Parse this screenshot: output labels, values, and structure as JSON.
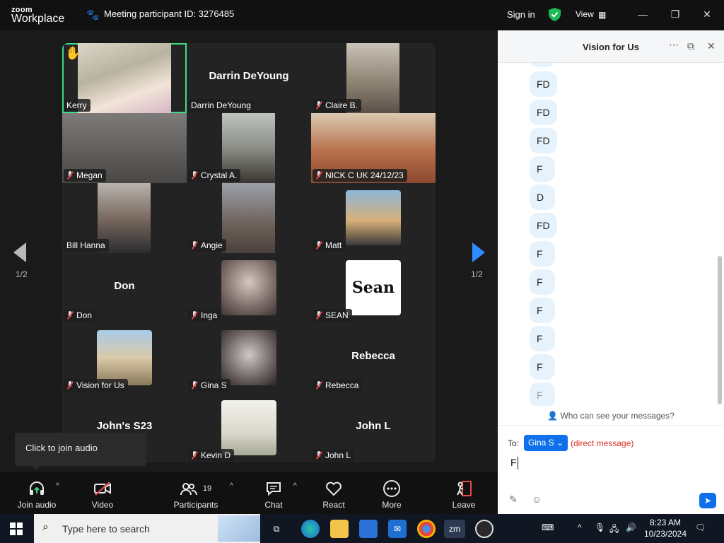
{
  "titlebar": {
    "logo_top": "zoom",
    "logo_bottom": "Workplace",
    "meeting_id": "Meeting participant ID: 3276485",
    "sign_in": "Sign in",
    "view": "View",
    "icons": [
      "paw-icon",
      "shield-check-icon",
      "grid-icon",
      "minimize-icon",
      "restore-icon",
      "close-icon"
    ]
  },
  "gallery": {
    "page_left": "1/2",
    "page_right": "1/2",
    "tiles": [
      {
        "name": "Kerry",
        "raised_hand": true,
        "active": true
      },
      {
        "name": "Darrin DeYoung",
        "big_name": "Darrin DeYoung"
      },
      {
        "name": "Claire B."
      },
      {
        "name": "Megan"
      },
      {
        "name": "Crystal A."
      },
      {
        "name": "NICK C  UK  24/12/23"
      },
      {
        "name": "Bill Hanna"
      },
      {
        "name": "Angie"
      },
      {
        "name": "Matt"
      },
      {
        "name": "Don",
        "big_name": "Don"
      },
      {
        "name": "Inga"
      },
      {
        "name": "SEAN",
        "thumb_text": "Sean"
      },
      {
        "name": "Vision for Us"
      },
      {
        "name": "Gina S"
      },
      {
        "name": "Rebecca",
        "big_name": "Rebecca"
      },
      {
        "name": "John's S23",
        "big_name": "John's S23"
      },
      {
        "name": "Kevin D"
      },
      {
        "name": "John L",
        "big_name": "John L"
      }
    ]
  },
  "tooltip": "Click to join audio",
  "toolbar": {
    "join_audio": "Join audio",
    "video": "Video",
    "participants": "Participants",
    "participants_count": "19",
    "chat": "Chat",
    "react": "React",
    "more": "More",
    "leave": "Leave"
  },
  "chat": {
    "title": "Vision for Us",
    "messages": [
      "FD",
      "FD",
      "FD",
      "F",
      "D",
      "FD",
      "F",
      "F",
      "F",
      "F",
      "F",
      "F"
    ],
    "who_can_see": "Who can see your messages?",
    "to_label": "To:",
    "recipient": "Gina S",
    "direct_message": "(direct message)",
    "draft": "F"
  },
  "taskbar": {
    "search_placeholder": "Type here to search",
    "time": "8:23 AM",
    "date": "10/23/2024",
    "zoom_label": "zm"
  },
  "colors": {
    "accent": "#0e71eb",
    "active_speaker": "#3ddc84",
    "muted_red": "#e5484d",
    "chat_bubble": "#e6f2fc"
  }
}
